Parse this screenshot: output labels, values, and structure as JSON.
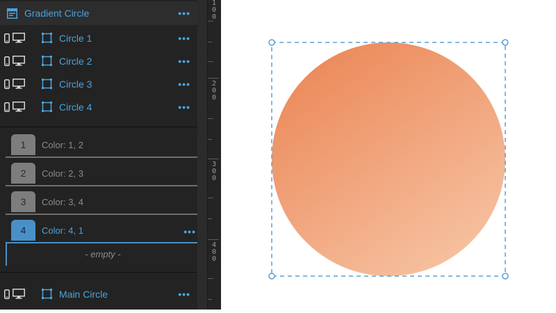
{
  "header": {
    "title": "Gradient Circle",
    "more": "•••"
  },
  "items": [
    {
      "label": "Circle 1",
      "more": "•••"
    },
    {
      "label": "Circle 2",
      "more": "•••"
    },
    {
      "label": "Circle 3",
      "more": "•••"
    },
    {
      "label": "Circle 4",
      "more": "•••"
    }
  ],
  "colors": [
    {
      "number": "1",
      "label": "Color: 1, 2"
    },
    {
      "number": "2",
      "label": "Color: 2, 3"
    },
    {
      "number": "3",
      "label": "Color: 3, 4"
    },
    {
      "number": "4",
      "label": "Color: 4, 1",
      "more": "•••"
    }
  ],
  "empty_text": "- empty -",
  "main_item": {
    "label": "Main Circle",
    "more": "•••"
  },
  "ruler": {
    "labels": [
      "100",
      "200",
      "300",
      "400"
    ]
  },
  "gradient": {
    "start": "#ec8a5b",
    "end": "#f6c1a0"
  },
  "accent": "#4aa3df"
}
